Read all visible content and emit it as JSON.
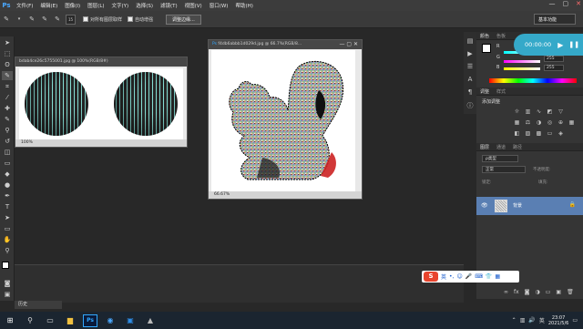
{
  "app": {
    "logo": "Ps"
  },
  "menu": [
    "文件(F)",
    "编辑(E)",
    "图像(I)",
    "图层(L)",
    "文字(Y)",
    "选择(S)",
    "滤镜(T)",
    "视图(V)",
    "窗口(W)",
    "帮助(H)"
  ],
  "window_controls": [
    "—",
    "▢",
    "✕"
  ],
  "options": {
    "brush_size": "15",
    "sample_all_layers": "对所有图层取样",
    "auto_enhance": "自动增强",
    "refine_edge": "调整边缘...",
    "workspace": "基本功能"
  },
  "doc1": {
    "title": "bdab4ce26c5755001.jpg @ 100%(RGB/8#)",
    "zoom": "100%"
  },
  "doc2": {
    "title": "f4db6abbb1d029d.jpg @ 66.7%(RGB/8...",
    "zoom": "66.67%"
  },
  "color_panel": {
    "tabs": [
      "颜色",
      "色板"
    ],
    "channels": [
      {
        "label": "R",
        "value": ""
      },
      {
        "label": "G",
        "value": "255"
      },
      {
        "label": "B",
        "value": "255"
      }
    ]
  },
  "media": {
    "time": "00:00:00"
  },
  "adjust_panel": {
    "tabs": [
      "调整",
      "样式"
    ],
    "title": "添加调整"
  },
  "layers_panel": {
    "tabs": [
      "图层",
      "通道",
      "路径"
    ],
    "kind_label": "ρ类型",
    "blend_mode": "正常",
    "opacity_label": "不透明度:",
    "lock_label": "锁定:",
    "fill_label": "填充:",
    "layer_name": "背景"
  },
  "bottom_panel": {
    "tab": "历史"
  },
  "ime": {
    "label": "英"
  },
  "taskbar": {
    "time": "23:07",
    "date": "2021/5/6"
  },
  "colors": {
    "accent": "#31a8ff",
    "layer_selected": "#5a7fb3",
    "media_bg": "#35a9c9"
  }
}
